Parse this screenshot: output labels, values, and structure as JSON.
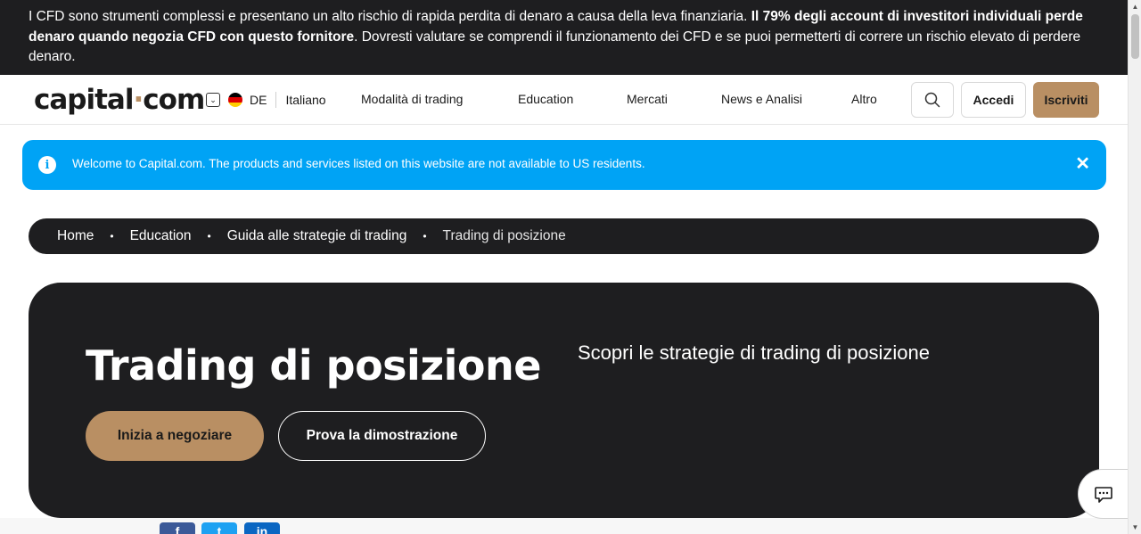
{
  "risk_warning": {
    "part1": "I CFD sono strumenti complessi e presentano un alto rischio di rapida perdita di denaro a causa della leva finanziaria. ",
    "bold": "Il 79% degli account di investitori individuali perde denaro quando negozia CFD con questo fornitore",
    "part2": ". Dovresti valutare se comprendi il funzionamento dei CFD e se puoi permetterti di correre un rischio elevato di perdere denaro."
  },
  "header": {
    "logo_left": "capital",
    "logo_dot": "·",
    "logo_right": "com",
    "country_code": "DE",
    "language": "Italiano",
    "nav": [
      "Modalità di trading",
      "Education",
      "Mercati",
      "News e Analisi",
      "Altro"
    ],
    "login_label": "Accedi",
    "signup_label": "Iscriviti"
  },
  "banner": {
    "message": "Welcome to Capital.com. The products and services listed on this website are not available to US residents.",
    "info_glyph": "i",
    "close_glyph": "✕"
  },
  "breadcrumb": {
    "items": [
      "Home",
      "Education",
      "Guida alle strategie di trading"
    ],
    "separator": "•",
    "current": "Trading di posizione"
  },
  "hero": {
    "title": "Trading di posizione",
    "subtitle": "Scopri le strategie di trading di posizione",
    "cta_primary": "Inizia a negoziare",
    "cta_secondary": "Prova la dimostrazione"
  },
  "share": {
    "facebook_glyph": "f",
    "twitter_glyph": "t",
    "linkedin_glyph": "in"
  },
  "icons": {
    "search": "search-icon",
    "chevron": "chevron-down-icon",
    "flag": "germany-flag-icon",
    "info": "info-icon",
    "close": "close-icon",
    "chat": "chat-icon"
  },
  "colors": {
    "dark": "#1e1e20",
    "accent": "#b98f63",
    "banner": "#00a3f5"
  }
}
